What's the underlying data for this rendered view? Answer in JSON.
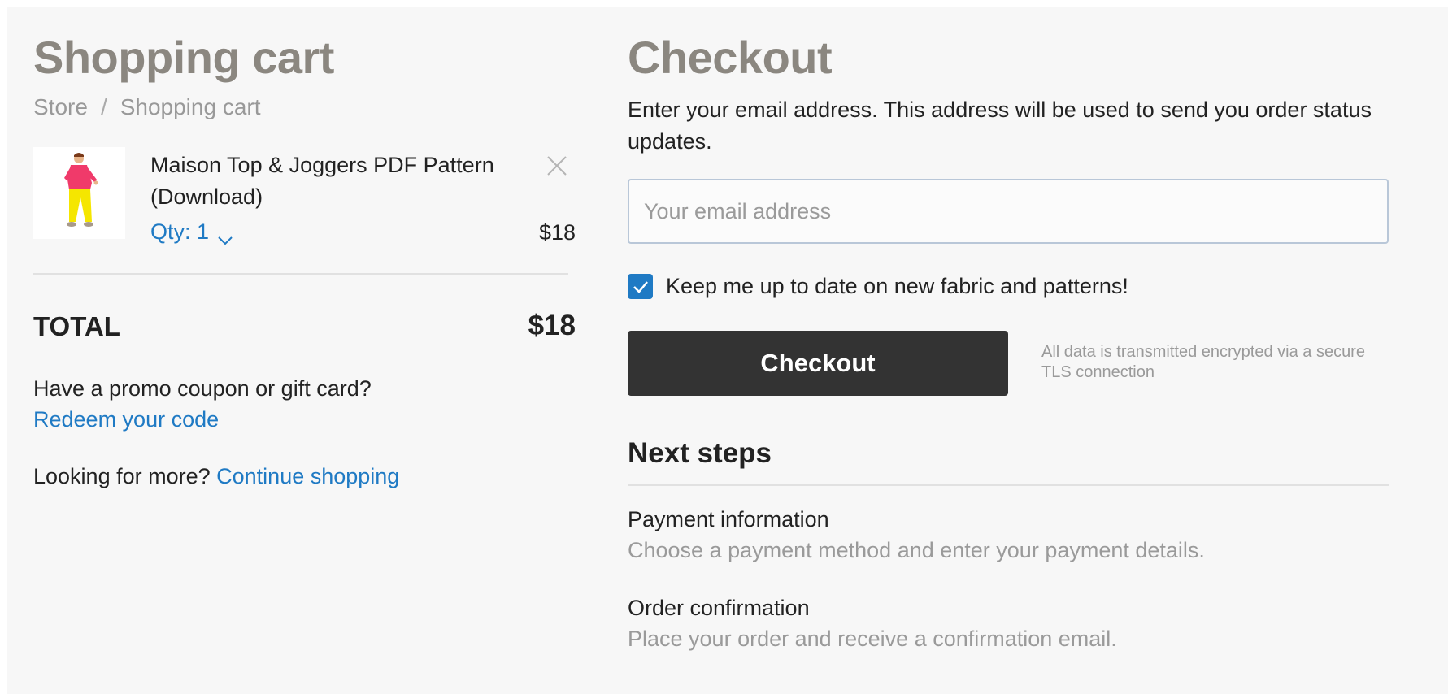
{
  "cart": {
    "title": "Shopping cart",
    "breadcrumb": {
      "items": [
        "Store",
        "Shopping cart"
      ],
      "separator": "/"
    },
    "item": {
      "image_icon": "product-illustration",
      "name": "Maison Top & Joggers PDF Pattern (Download)",
      "qty_label": "Qty: 1",
      "qty_icon": "chevron-down-icon",
      "remove_icon": "close-icon",
      "price": "$18"
    },
    "total": {
      "label": "TOTAL",
      "value": "$18"
    },
    "promo": {
      "question": "Have a promo coupon or gift card?",
      "link": "Redeem your code"
    },
    "more": {
      "text": "Looking for more?",
      "link": "Continue shopping"
    }
  },
  "checkout": {
    "title": "Checkout",
    "description": "Enter your email address. This address will be used to send you order status updates.",
    "email": {
      "value": "",
      "placeholder": "Your email address"
    },
    "newsletter": {
      "checked": true,
      "label": "Keep me up to date on new fabric and patterns!"
    },
    "button_label": "Checkout",
    "secure_note": "All data is transmitted encrypted via a secure TLS connection"
  },
  "next_steps": {
    "title": "Next steps",
    "steps": [
      {
        "title": "Payment information",
        "description": "Choose a payment method and enter your payment details."
      },
      {
        "title": "Order confirmation",
        "description": "Place your order and receive a confirmation email."
      }
    ]
  },
  "colors": {
    "link": "#1f7ac4",
    "heading_gray": "#8b8780",
    "button_dark": "#333333",
    "background": "#f7f7f7"
  }
}
